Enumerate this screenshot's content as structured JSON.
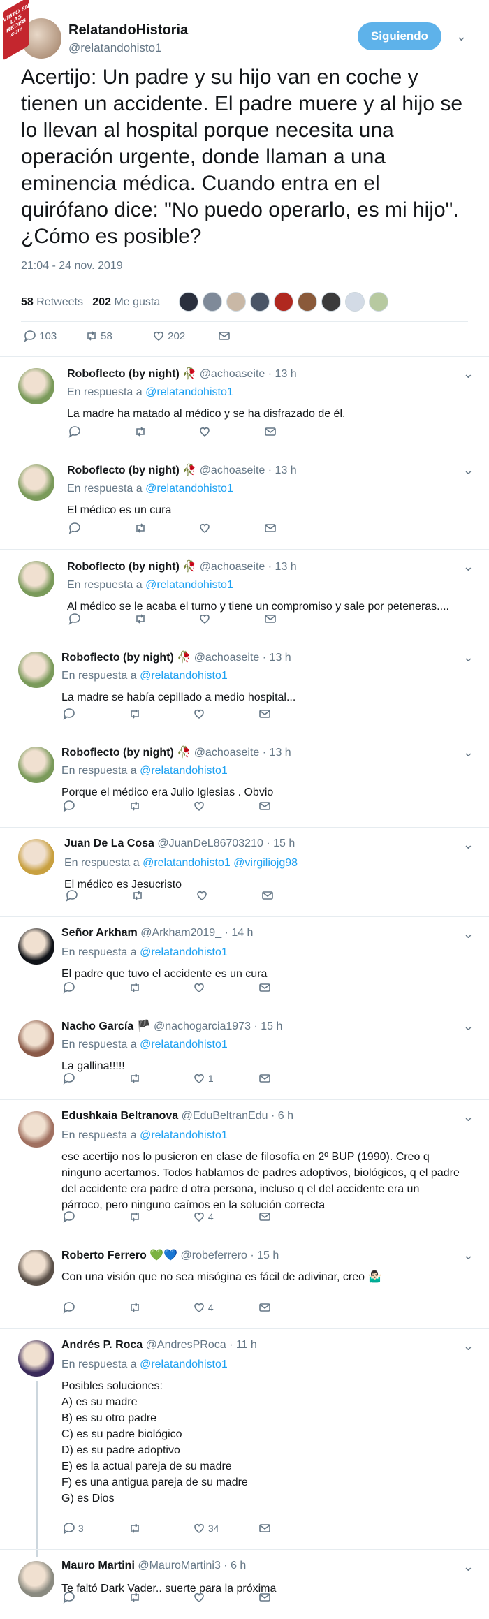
{
  "watermark": "VISTO EN LAS REDES .com",
  "tweet": {
    "name": "RelatandoHistoria",
    "handle": "@relatandohisto1",
    "follow_label": "Siguiendo",
    "text": "Acertijo: Un padre y su hijo van en coche y tienen un accidente. El padre muere y al hijo se lo llevan al hospital porque necesita una operación urgente, donde llaman a una eminencia médica. Cuando entra en el quirófano dice: \"No puedo operarlo, es mi hijo\". ¿Cómo es posible?",
    "date": "21:04 - 24 nov. 2019",
    "retweets": "58",
    "retweets_label": "Retweets",
    "likes": "202",
    "likes_label": "Me gusta",
    "reply_count": "103",
    "rt_count": "58",
    "like_count": "202",
    "liker_colors": [
      "#2a2f3d",
      "#7f8a99",
      "#c9b8a6",
      "#4a5566",
      "#b0281f",
      "#8a5a3a",
      "#3b3b3b",
      "#d3dbe6",
      "#b7c9a0"
    ]
  },
  "replies": [
    {
      "name": "Roboflecto (by night)",
      "emoji": "🥀",
      "handle": "@achoaseite",
      "time": "13 h",
      "in_reply_label": "En respuesta a",
      "mention": "@relatandohisto1",
      "text": "La madre ha matado al médico y se ha disfrazado de él.",
      "reply_count": "",
      "rt_count": "",
      "like_count": "",
      "avatar_color": "#7a9a5a"
    },
    {
      "name": "Roboflecto (by night)",
      "emoji": "🥀",
      "handle": "@achoaseite",
      "time": "13 h",
      "in_reply_label": "En respuesta a",
      "mention": "@relatandohisto1",
      "text": "El médico es un cura",
      "reply_count": "",
      "rt_count": "",
      "like_count": "",
      "avatar_color": "#7a9a5a"
    },
    {
      "name": "Roboflecto (by night)",
      "emoji": "🥀",
      "handle": "@achoaseite",
      "time": "13 h",
      "in_reply_label": "En respuesta a",
      "mention": "@relatandohisto1",
      "text": "Al médico se le acaba el turno y tiene un compromiso y sale por peteneras....",
      "reply_count": "",
      "rt_count": "",
      "like_count": "",
      "avatar_color": "#7a9a5a"
    },
    {
      "name": "Roboflecto (by night)",
      "emoji": "🥀",
      "handle": "@achoaseite",
      "time": "13 h",
      "in_reply_label": "En respuesta a",
      "mention": "@relatandohisto1",
      "text": "La madre se había cepillado a medio hospital...",
      "reply_count": "",
      "rt_count": "",
      "like_count": "",
      "avatar_color": "#7a9a5a"
    },
    {
      "name": "Roboflecto (by night)",
      "emoji": "🥀",
      "handle": "@achoaseite",
      "time": "13 h",
      "in_reply_label": "En respuesta a",
      "mention": "@relatandohisto1",
      "text": "Porque el médico era Julio Iglesias . Obvio",
      "reply_count": "",
      "rt_count": "",
      "like_count": "",
      "avatar_color": "#7a9a5a"
    },
    {
      "name": "Juan De La Cosa",
      "emoji": "",
      "handle": "@JuanDeL86703210",
      "time": "15 h",
      "in_reply_label": "En respuesta a",
      "mention": "@relatandohisto1 @virgiliojg98",
      "text": "El médico es Jesucristo",
      "reply_count": "",
      "rt_count": "",
      "like_count": "",
      "avatar_color": "#c8a040"
    },
    {
      "name": "Señor Arkham",
      "emoji": "",
      "handle": "@Arkham2019_",
      "time": "14 h",
      "in_reply_label": "En respuesta a",
      "mention": "@relatandohisto1",
      "text": "El padre que tuvo el accidente es un cura",
      "reply_count": "",
      "rt_count": "",
      "like_count": "",
      "avatar_color": "#101318"
    },
    {
      "name": "Nacho García",
      "emoji": "🏴",
      "handle": "@nachogarcia1973",
      "time": "15 h",
      "in_reply_label": "En respuesta a",
      "mention": "@relatandohisto1",
      "text": "La gallina!!!!!",
      "reply_count": "",
      "rt_count": "",
      "like_count": "1",
      "avatar_color": "#8a5a48"
    },
    {
      "name": "Edushkaia Beltranova",
      "emoji": "",
      "handle": "@EduBeltranEdu",
      "time": "6 h",
      "in_reply_label": "En respuesta a",
      "mention": "@relatandohisto1",
      "text": "ese acertijo nos lo pusieron en clase de filosofía en 2º BUP (1990). Creo q ninguno acertamos. Todos hablamos de padres adoptivos, biológicos, q el padre del accidente era padre d otra persona, incluso q el del accidente era un párroco, pero ninguno caímos en la solución correcta",
      "reply_count": "",
      "rt_count": "",
      "like_count": "4",
      "avatar_color": "#a07060"
    },
    {
      "name": "Roberto Ferrero",
      "emoji": "💚💙",
      "handle": "@robeferrero",
      "time": "15 h",
      "in_reply_label": "",
      "mention": "",
      "text": "Con una visión que no sea misógina es fácil de adivinar, creo 🤷🏻‍♂️",
      "reply_count": "",
      "rt_count": "",
      "like_count": "4",
      "avatar_color": "#5a5048"
    },
    {
      "name": "Andrés P. Roca",
      "emoji": "",
      "handle": "@AndresPRoca",
      "time": "11 h",
      "in_reply_label": "En respuesta a",
      "mention": "@relatandohisto1",
      "text": "Posibles soluciones:\nA) es su madre\nB) es su otro padre\nC) es su padre biológico\nD) es su padre adoptivo\nE) es la actual pareja de su madre\nF) es una antigua pareja de su madre\nG) es Dios",
      "reply_count": "3",
      "rt_count": "",
      "like_count": "34",
      "avatar_color": "#3a2a5a"
    },
    {
      "name": "Mauro Martini",
      "emoji": "",
      "handle": "@MauroMartini3",
      "time": "6 h",
      "in_reply_label": "",
      "mention": "",
      "text": "Te faltó Dark Vader.. suerte para la próxima",
      "reply_count": "",
      "rt_count": "",
      "like_count": "",
      "avatar_color": "#8a8a80"
    }
  ]
}
